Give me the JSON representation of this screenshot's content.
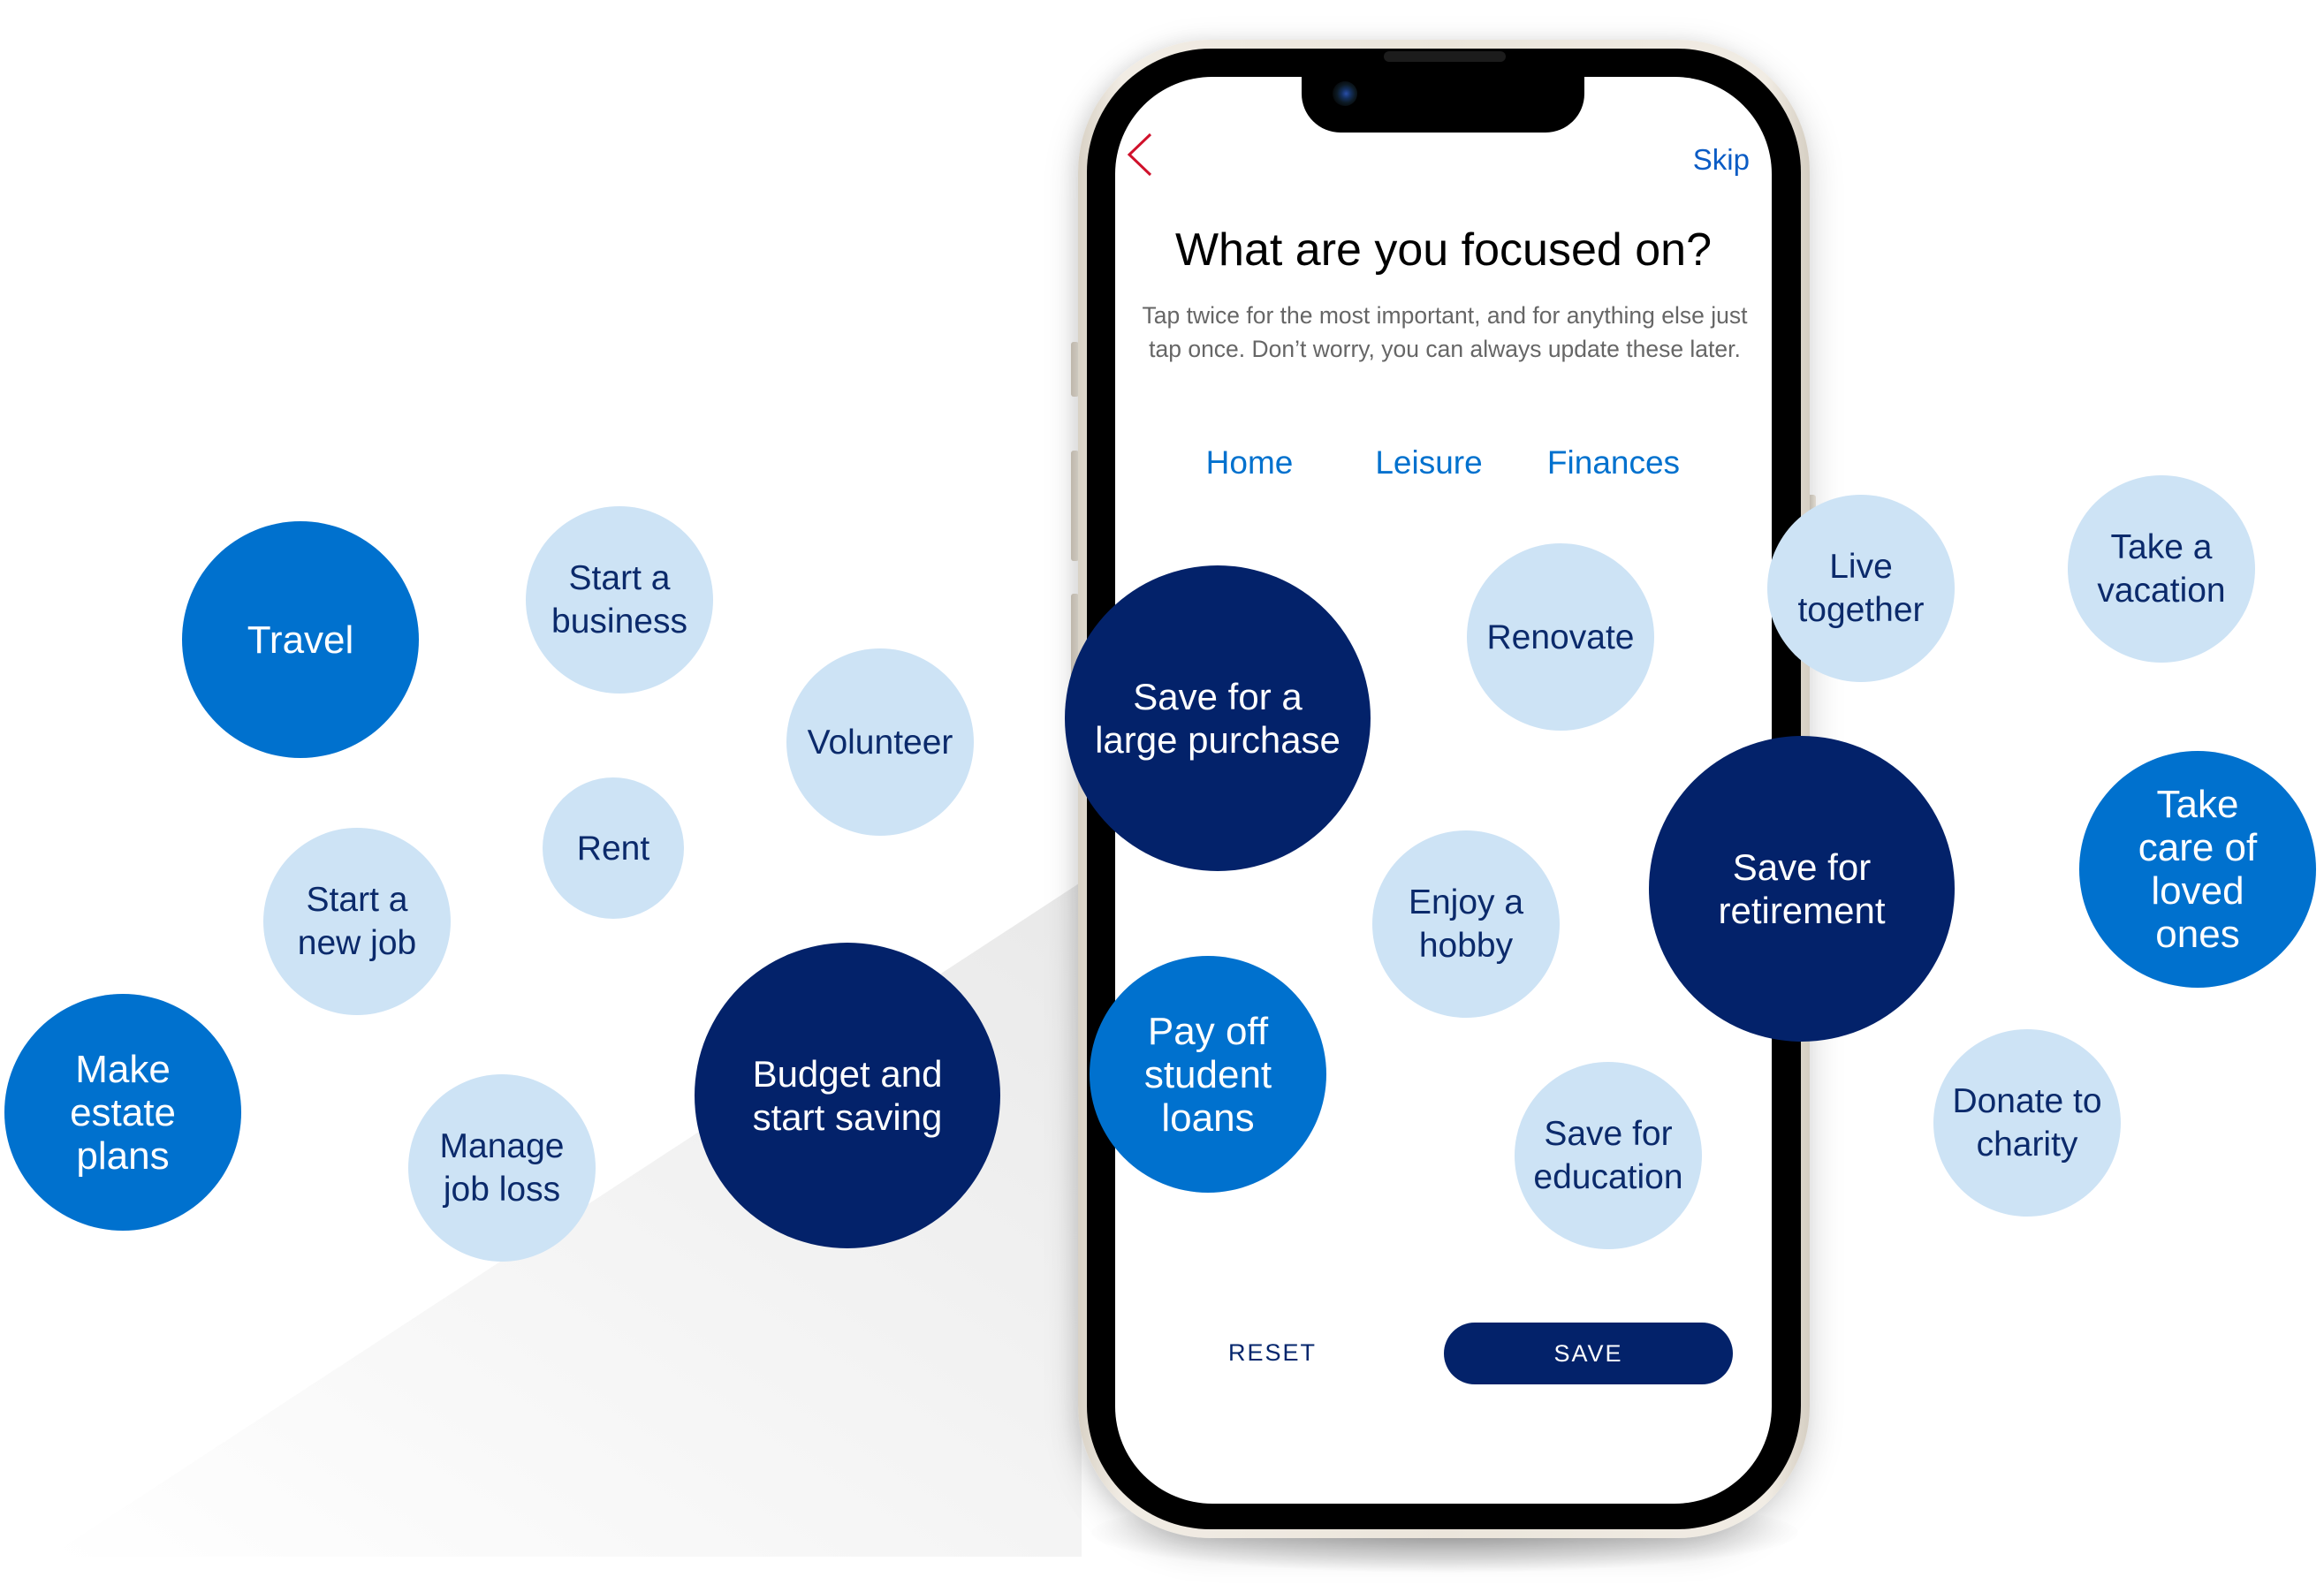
{
  "colors": {
    "unselected_bubble": "#cde3f5",
    "unselected_text": "#0b2a6b",
    "selected_once": "#0071ce",
    "most_important": "#03226a",
    "link_blue": "#0071ce",
    "skip_blue": "#0b5cc5",
    "back_arrow_red": "#d0112b"
  },
  "header": {
    "back_icon": "chevron-left-icon",
    "skip_label": "Skip"
  },
  "main": {
    "title": "What are you focused on?",
    "subtitle": "Tap twice for the most important, and for anything else just tap once. Don’t worry, you can always update these later.",
    "categories": [
      {
        "label": "Home"
      },
      {
        "label": "Leisure"
      },
      {
        "label": "Finances"
      }
    ]
  },
  "footer": {
    "reset_label": "RESET",
    "save_label": "SAVE"
  },
  "goals": [
    {
      "label": "Travel",
      "state": "selected"
    },
    {
      "label": "Start a\nbusiness",
      "state": "unselected"
    },
    {
      "label": "Volunteer",
      "state": "unselected"
    },
    {
      "label": "Rent",
      "state": "unselected"
    },
    {
      "label": "Start a\nnew job",
      "state": "unselected"
    },
    {
      "label": "Make\nestate\nplans",
      "state": "selected"
    },
    {
      "label": "Manage\njob loss",
      "state": "unselected"
    },
    {
      "label": "Budget and\nstart saving",
      "state": "most-important"
    },
    {
      "label": "Save for a\nlarge purchase",
      "state": "most-important"
    },
    {
      "label": "Renovate",
      "state": "unselected"
    },
    {
      "label": "Enjoy a\nhobby",
      "state": "unselected"
    },
    {
      "label": "Pay off\nstudent\nloans",
      "state": "selected"
    },
    {
      "label": "Save for\neducation",
      "state": "unselected"
    },
    {
      "label": "Live\ntogether",
      "state": "unselected"
    },
    {
      "label": "Take a\nvacation",
      "state": "unselected"
    },
    {
      "label": "Save for\nretirement",
      "state": "most-important"
    },
    {
      "label": "Take\ncare of\nloved\nones",
      "state": "selected"
    },
    {
      "label": "Donate to\ncharity",
      "state": "unselected"
    }
  ]
}
